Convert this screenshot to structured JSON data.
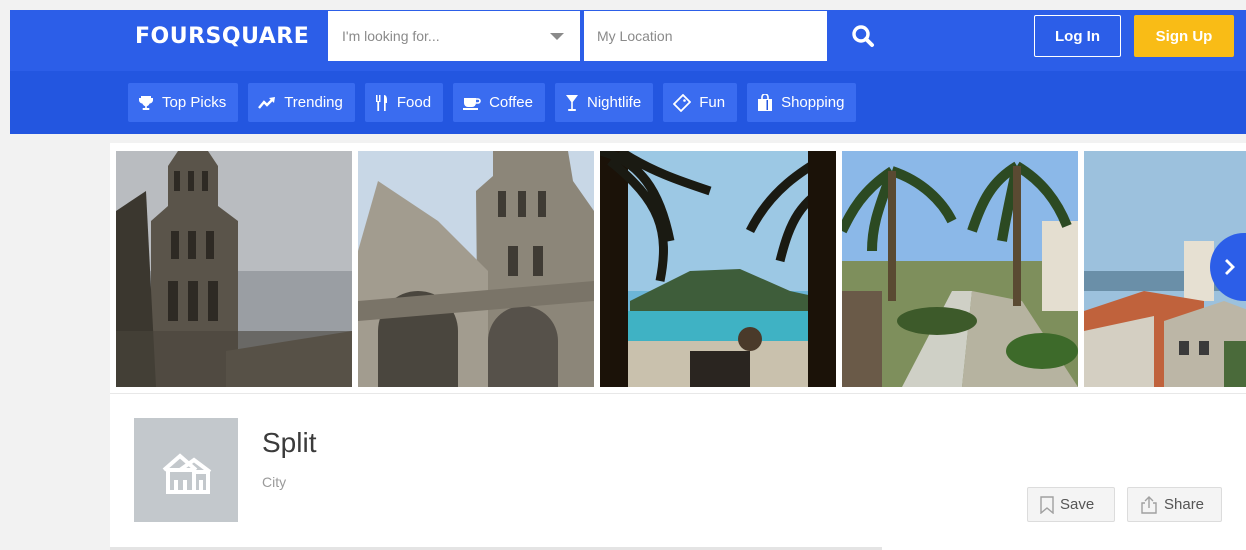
{
  "header": {
    "logo": "FOURSQUARE",
    "search_placeholder": "I'm looking for...",
    "location_placeholder": "My Location",
    "login_label": "Log In",
    "signup_label": "Sign Up"
  },
  "categories": [
    {
      "label": "Top Picks",
      "icon": "trophy-icon"
    },
    {
      "label": "Trending",
      "icon": "trending-icon"
    },
    {
      "label": "Food",
      "icon": "fork-knife-icon"
    },
    {
      "label": "Coffee",
      "icon": "coffee-cup-icon"
    },
    {
      "label": "Nightlife",
      "icon": "cocktail-icon"
    },
    {
      "label": "Fun",
      "icon": "ticket-icon"
    },
    {
      "label": "Shopping",
      "icon": "shopping-bag-icon"
    }
  ],
  "venue": {
    "name": "Split",
    "category": "City",
    "save_label": "Save",
    "share_label": "Share"
  },
  "colors": {
    "brand_blue": "#2c5ee8",
    "category_blue": "#2356e0",
    "signup_yellow": "#f9bc16",
    "placeholder_gray": "#c3c8cc"
  }
}
